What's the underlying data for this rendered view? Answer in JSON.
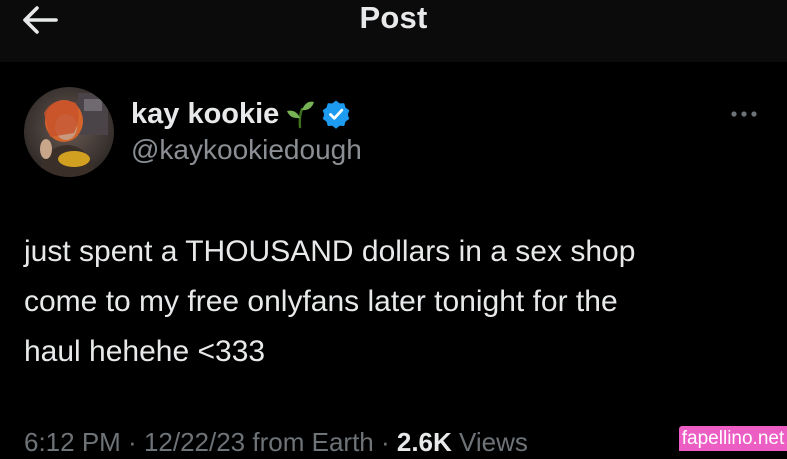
{
  "header": {
    "title": "Post",
    "back_icon": "arrow-left-icon"
  },
  "author": {
    "display_name": "kay kookie",
    "emoji": "🌱",
    "emoji_icon": "seedling-icon",
    "verified_icon": "verified-badge-icon",
    "handle": "@kaykookiedough"
  },
  "more_icon": "more-options-icon",
  "post": {
    "lines": [
      "just spent a THOUSAND dollars in a sex shop",
      "come to my free onlyfans later tonight for the",
      "haul hehehe <333"
    ]
  },
  "meta": {
    "time": "6:12 PM",
    "sep1": " · ",
    "date": "12/22/23",
    "from_text": " from Earth",
    "sep2": " · ",
    "views_count": "2.6K",
    "views_label": " Views"
  },
  "watermark": {
    "text": "fapellino.net"
  },
  "colors": {
    "background": "#000000",
    "header_background": "#0b0b0c",
    "primary_text": "#e7e9ea",
    "secondary_text": "#8b8f94",
    "verified_blue": "#1d9bf0",
    "seedling_green": "#77b255",
    "watermark_pink": "#ec5ec4"
  }
}
